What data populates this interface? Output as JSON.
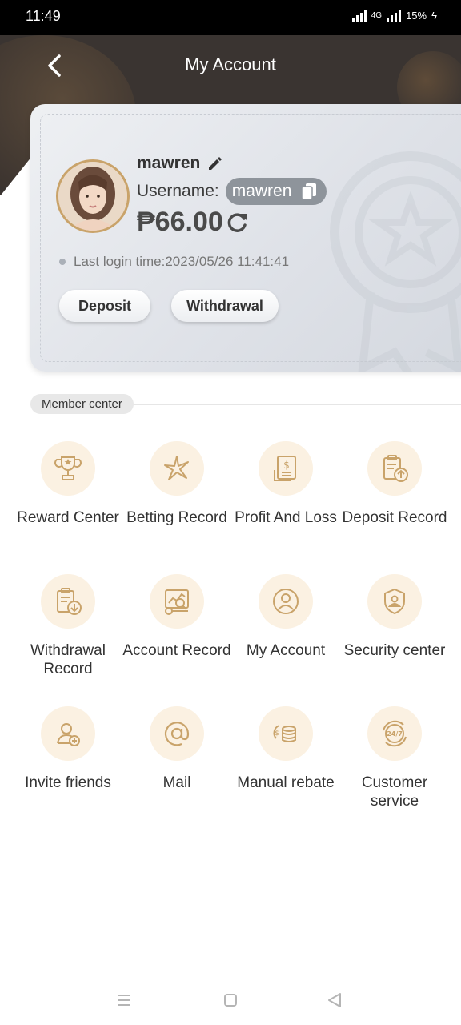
{
  "status": {
    "time": "11:49",
    "network": "4G",
    "battery": "15%"
  },
  "header": {
    "title": "My Account"
  },
  "profile": {
    "nickname": "mawren",
    "username_label": "Username:",
    "username": "mawren",
    "balance": "₱66.00",
    "last_login": "Last login time:2023/05/26 11:41:41",
    "deposit_label": "Deposit",
    "withdraw_label": "Withdrawal"
  },
  "member_center": {
    "tag": "Member center",
    "items": [
      {
        "label": "Reward Center",
        "icon": "trophy-icon"
      },
      {
        "label": "Betting Record",
        "icon": "star-sparkle-icon"
      },
      {
        "label": "Profit And Loss",
        "icon": "dollar-document-icon"
      },
      {
        "label": "Deposit Record",
        "icon": "clipboard-upload-icon"
      },
      {
        "label": "Withdrawal Record",
        "icon": "clipboard-download-icon"
      },
      {
        "label": "Account Record",
        "icon": "analytics-screen-icon"
      },
      {
        "label": "My Account",
        "icon": "user-circle-icon"
      },
      {
        "label": "Security center",
        "icon": "shield-user-icon"
      },
      {
        "label": "Invite friends",
        "icon": "add-user-icon"
      },
      {
        "label": "Mail",
        "icon": "at-sign-icon"
      },
      {
        "label": "Manual rebate",
        "icon": "coins-rebate-icon"
      },
      {
        "label": "Customer service",
        "icon": "24-7-service-icon"
      }
    ]
  },
  "colors": {
    "header_bg": "#3a3431",
    "icon_gold": "#c9a36a",
    "icon_circle_bg": "#fbf1e2"
  }
}
